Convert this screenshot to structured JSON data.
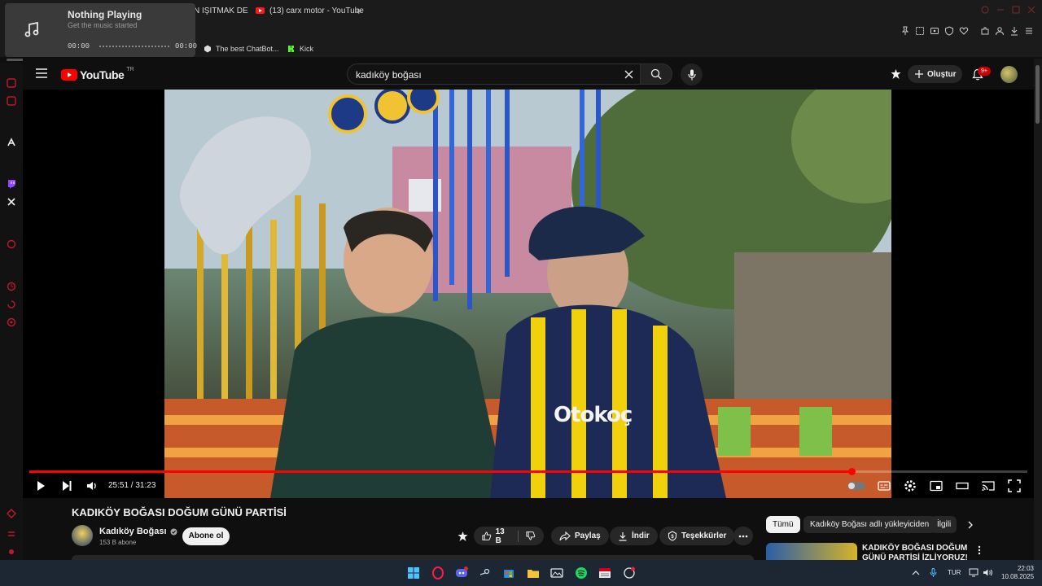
{
  "browser": {
    "tabs": [
      {
        "label": "N IŞITMAK DE"
      },
      {
        "label": "(13) carx motor - YouTube"
      }
    ],
    "bookmarks": [
      {
        "label": "The best ChatBot..."
      },
      {
        "label": "Kick"
      }
    ],
    "new_tab_symbol": "+"
  },
  "music_widget": {
    "title": "Nothing Playing",
    "subtitle": "Get the music started",
    "time_start": "00:00",
    "time_end": "00:00",
    "icon": "music-note-icon"
  },
  "youtube": {
    "logo_text": "YouTube",
    "logo_region": "TR",
    "search_query": "kadıköy boğası",
    "create_label": "Oluştur",
    "notif_badge": "9+"
  },
  "player": {
    "time": "25:51 / 31:23",
    "progress_fraction": 0.824,
    "jersey_text": "Otokoç"
  },
  "video": {
    "title": "KADIKÖY BOĞASI DOĞUM GÜNÜ PARTİSİ",
    "channel_name": "Kadıköy Boğası",
    "subscribers": "153 B abone",
    "subscribe_label": "Abone ol",
    "like_count": "13 B",
    "share_label": "Paylaş",
    "download_label": "İndir",
    "thanks_label": "Teşekkürler"
  },
  "related": {
    "chips": [
      "Tümü",
      "Kadıköy Boğası adlı yükleyiciden",
      "İlgili"
    ],
    "first_title": "KADIKÖY BOĞASI DOĞUM GÜNÜ PARTİSİ İZLİYORUZ!"
  },
  "taskbar": {
    "language": "TUR",
    "time": "22:03",
    "date": "10.08.2025"
  },
  "colors": {
    "accent_red": "#ff0000",
    "background": "#0f0f0f"
  }
}
